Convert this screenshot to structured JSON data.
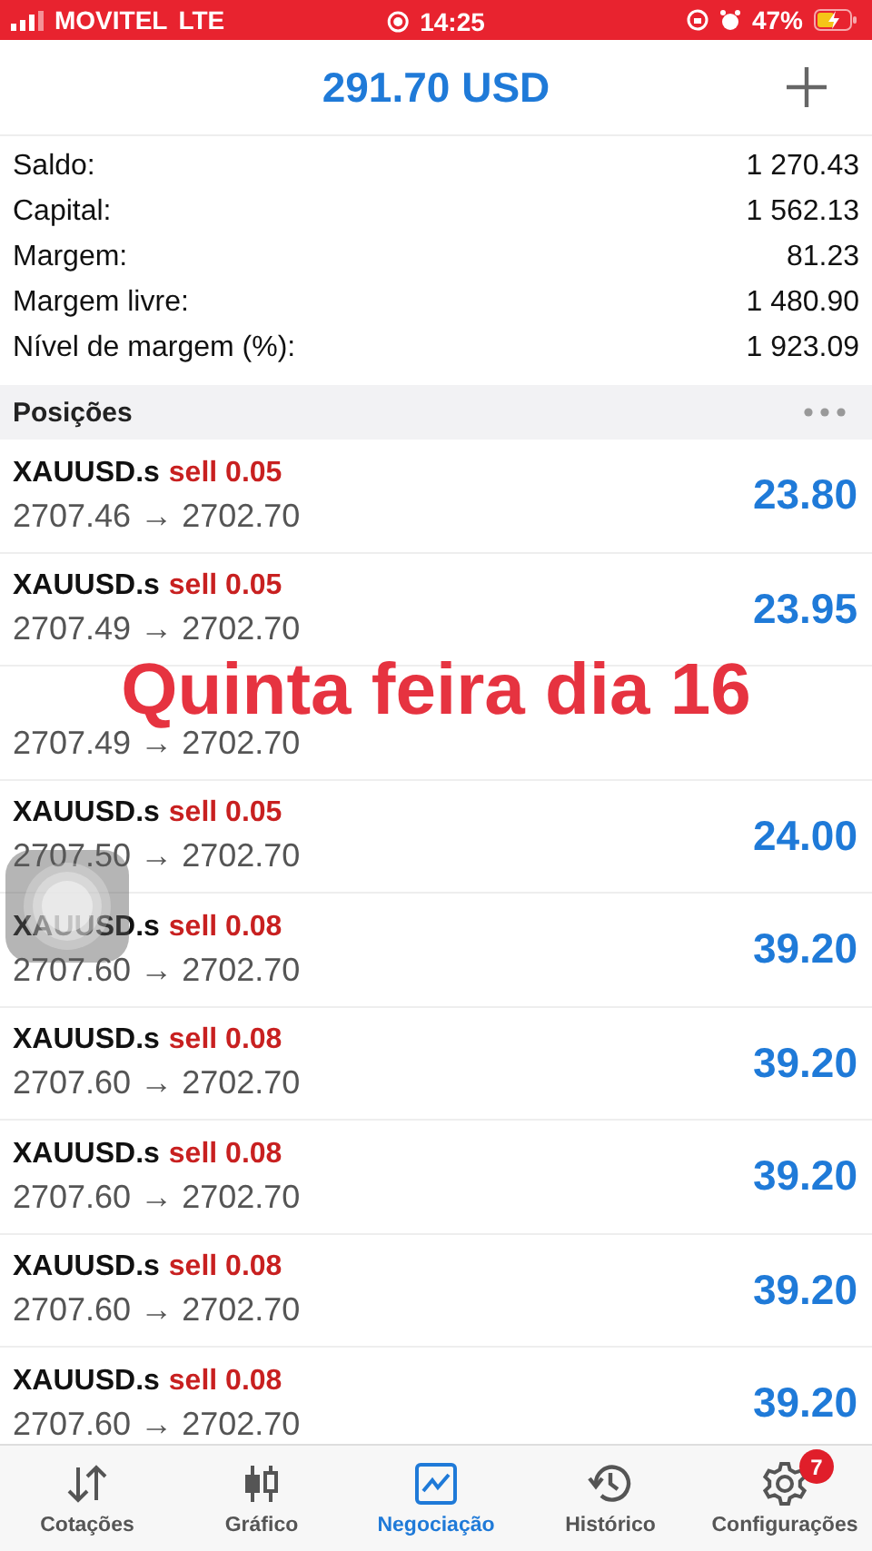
{
  "status_bar": {
    "carrier": "MOVITEL",
    "network": "LTE",
    "time": "14:25",
    "battery": "47%"
  },
  "header": {
    "title": "291.70 USD"
  },
  "summary": [
    {
      "label": "Saldo:",
      "value": "1 270.43"
    },
    {
      "label": "Capital:",
      "value": "1 562.13"
    },
    {
      "label": "Margem:",
      "value": "81.23"
    },
    {
      "label": "Margem livre:",
      "value": "1 480.90"
    },
    {
      "label": "Nível de margem (%):",
      "value": "1 923.09"
    }
  ],
  "positions": {
    "title": "Posições",
    "rows": [
      {
        "symbol": "XAUUSD.s",
        "side": "sell 0.05",
        "prices": "2707.46 → 2702.70",
        "profit": "23.80"
      },
      {
        "symbol": "XAUUSD.s",
        "side": "sell 0.05",
        "prices": "2707.49 → 2702.70",
        "profit": "23.95"
      },
      {
        "prices": "2707.49 → 2702.70"
      },
      {
        "symbol": "XAUUSD.s",
        "side": "sell 0.05",
        "prices": "2707.50 → 2702.70",
        "profit": "24.00"
      },
      {
        "symbol": "XAUUSD.s",
        "side": "sell 0.08",
        "prices": "2707.60 → 2702.70",
        "profit": "39.20"
      },
      {
        "symbol": "XAUUSD.s",
        "side": "sell 0.08",
        "prices": "2707.60 → 2702.70",
        "profit": "39.20"
      },
      {
        "symbol": "XAUUSD.s",
        "side": "sell 0.08",
        "prices": "2707.60 → 2702.70",
        "profit": "39.20"
      },
      {
        "symbol": "XAUUSD.s",
        "side": "sell 0.08",
        "prices": "2707.60 → 2702.70",
        "profit": "39.20"
      },
      {
        "symbol": "XAUUSD.s",
        "side": "sell 0.08",
        "prices": "2707.60 → 2702.70",
        "profit": "39.20"
      }
    ]
  },
  "overlay_caption": "Quinta feira dia 16",
  "tabs": [
    {
      "label": "Cotações",
      "selected": false
    },
    {
      "label": "Gráfico",
      "selected": false
    },
    {
      "label": "Negociação",
      "selected": true
    },
    {
      "label": "Histórico",
      "selected": false
    },
    {
      "label": "Configurações",
      "selected": false,
      "badge": "7"
    }
  ]
}
